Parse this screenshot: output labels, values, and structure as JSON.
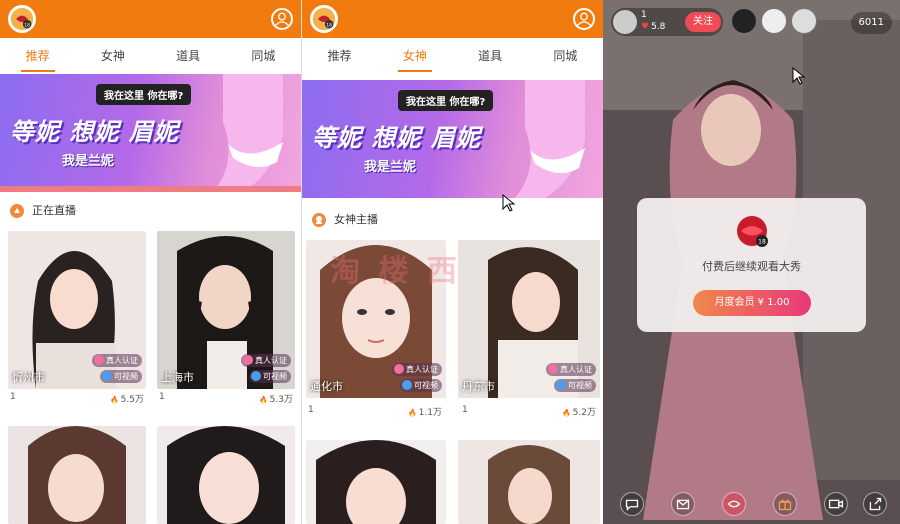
{
  "panel1": {
    "tabs": [
      "推荐",
      "女神",
      "道具",
      "同城"
    ],
    "banner": {
      "bubble": "我在这里 你在哪?",
      "headline": "等妮 想妮 眉妮",
      "sub": "我是兰妮"
    },
    "section_title": "正在直播",
    "cards": [
      {
        "city": "忻州市",
        "verify": "真人认证",
        "video": "可视频",
        "num": "1",
        "heat": "5.5万"
      },
      {
        "city": "上海市",
        "verify": "真人认证",
        "video": "可视频",
        "num": "1",
        "heat": "5.3万"
      },
      {
        "city": "",
        "verify": "",
        "video": "",
        "num": "",
        "heat": ""
      },
      {
        "city": "",
        "verify": "",
        "video": "",
        "num": "",
        "heat": ""
      }
    ]
  },
  "panel2": {
    "tabs": [
      "推荐",
      "女神",
      "道具",
      "同城"
    ],
    "banner": {
      "bubble": "我在这里 你在哪?",
      "headline": "等妮 想妮 眉妮",
      "sub": "我是兰妮"
    },
    "section_title": "女神主播",
    "cards": [
      {
        "city": "通化市",
        "verify": "真人认证",
        "video": "可视频",
        "num": "1",
        "heat": "1.1万"
      },
      {
        "city": "丹东市",
        "verify": "真人认证",
        "video": "可视频",
        "num": "1",
        "heat": "5.2万"
      },
      {
        "city": "",
        "verify": "",
        "video": "",
        "num": "",
        "heat": ""
      },
      {
        "city": "",
        "verify": "",
        "video": "",
        "num": "",
        "heat": ""
      }
    ]
  },
  "panel3": {
    "host": {
      "num": "1",
      "heat": "5.8"
    },
    "follow_label": "关注",
    "viewer_count": "6011",
    "paywall": {
      "message": "付费后继续观看大秀",
      "button": "月度会员 ¥ 1.00"
    }
  },
  "watermark": "淘 楼 西",
  "colors": {
    "brand": "#f27b10",
    "follow": "#f04b54"
  }
}
